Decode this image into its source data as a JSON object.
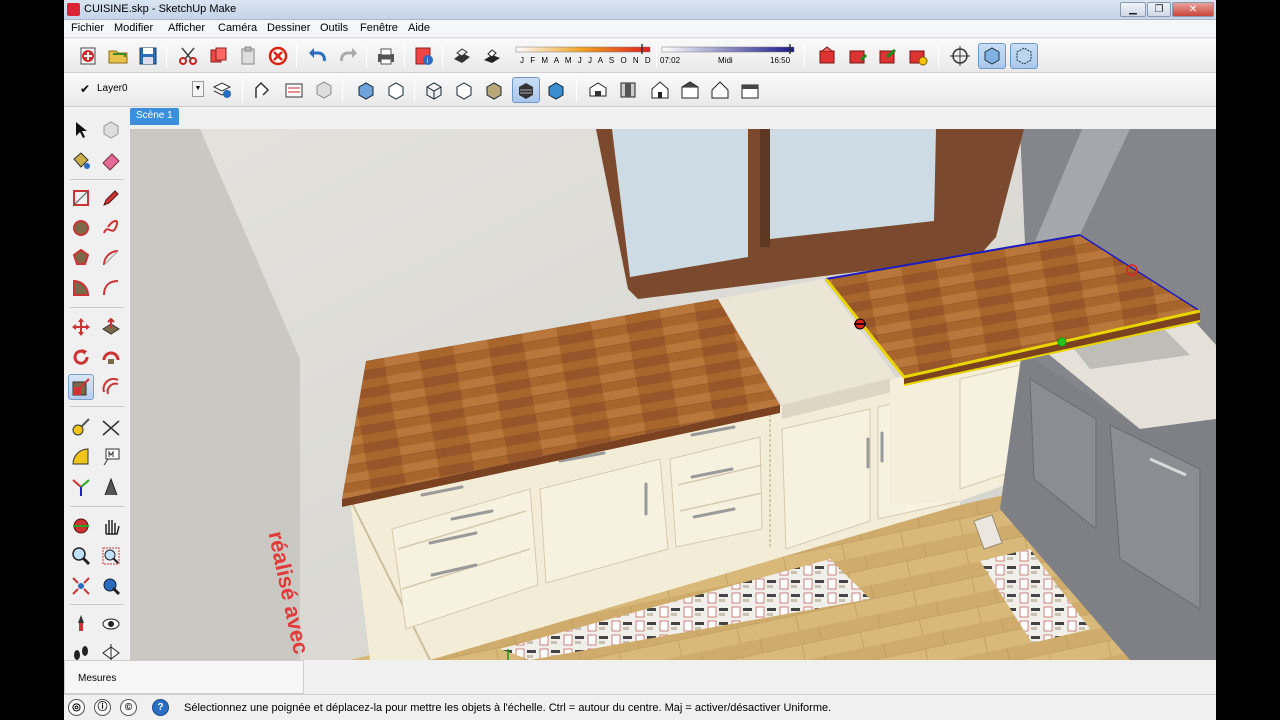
{
  "window": {
    "title": "CUISINE.skp - SketchUp Make",
    "minimize": "▁",
    "maximize": "❐",
    "close": "✕"
  },
  "menu": [
    "Fichier",
    "Modifier",
    "Afficher",
    "Caméra",
    "Dessiner",
    "Outils",
    "Fenêtre",
    "Aide"
  ],
  "shadows": {
    "months": "J F M A M J J A S O N D",
    "time_start": "07:02",
    "time_mid": "Midi",
    "time_end": "16:50"
  },
  "layer": {
    "check": "✔",
    "name": "Layer0",
    "dropdown": "▼"
  },
  "scene_tab": "Scène 1",
  "measure_label": "Mesures",
  "status_text": "Sélectionnez une poignée et déplacez-la pour mettre les objets à l'échelle. Ctrl = autour du centre. Maj = activer/désactiver Uniforme.",
  "status_icons": {
    "geo": "◎",
    "info": "ⓘ",
    "credits": "©",
    "help": "?"
  },
  "watermark": "réalisé avec C",
  "colors": {
    "selection": "#e8d400",
    "wood": "#a6602a",
    "scene_tab": "#3b8fdd"
  }
}
